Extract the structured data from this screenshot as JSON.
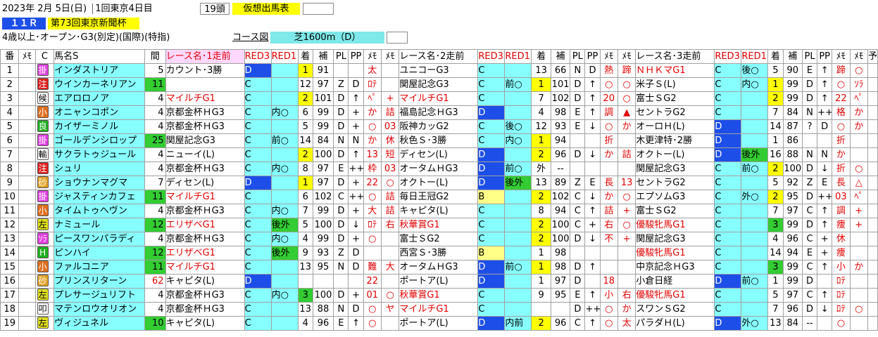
{
  "header": {
    "date": "2023年  2月  5日(日)",
    "meet": "1回東京4日目",
    "heads": "19頭",
    "tag": "仮想出馬表",
    "race_no": "１１Ｒ",
    "race_name": "第73回東京新聞杯",
    "condition": "4歳以上･オープン･G3(別定)(国際)(特指)",
    "course_label": "コース図",
    "course": "芝1600m（D）"
  },
  "head": {
    "ban": "番",
    "memo": "ﾒﾓ",
    "c": "C",
    "name": "馬名S",
    "kan": "間",
    "r1": "レース名･1走前",
    "r2": "レース名･2走前",
    "r3": "レース名･3走前",
    "k3": "RED3",
    "k1": "RED1",
    "chaku": "着",
    "ho": "補",
    "pl": "PL",
    "pp": "PP",
    "me": "ﾒﾓ",
    "nxt": "予"
  },
  "mark_colors": {
    "掛": "#e040e0",
    "注": "#e02020",
    "候": "#ffffff",
    "小": "#e07020",
    "良": "#20b020",
    "輸": "#ffffff",
    "砂": "#e0a020",
    "ｿﾗ": "#e040e0",
    "H": "#20b020",
    "左": "#e0e020",
    "叩": "#ffffff"
  },
  "rows": [
    {
      "n": "1",
      "m": "掛",
      "name": "インダストリア",
      "k": "5",
      "kc": "",
      "r1": {
        "name": "カウント･3勝",
        "red": false,
        "k3": "D",
        "k3c": "bl",
        "k1": "",
        "k1c": "cy",
        "ch": "1",
        "chc": "yl",
        "ho": "91",
        "pl": "",
        "pp": "",
        "m1": "太",
        "m2": ""
      },
      "r2": {
        "name": "ユニコーG3",
        "red": false,
        "k3": "C",
        "k3c": "cy",
        "k1": "",
        "k1c": "cy",
        "ch": "13",
        "chc": "",
        "ho": "66",
        "pl": "N",
        "pp": "D",
        "m1": "熱",
        "m2": "蹄"
      },
      "r3": {
        "name": "ＮＨＫマG1",
        "red": true,
        "k3": "C",
        "k3c": "cy",
        "k1": "後○",
        "k1c": "cy",
        "ch": "5",
        "chc": "",
        "ho": "90",
        "pl": "E",
        "pp": "↑",
        "m1": "蹄",
        "m2": "○"
      }
    },
    {
      "n": "2",
      "m": "注",
      "name": "ウインカーネリアン",
      "k": "11",
      "kc": "gr",
      "r1": {
        "name": "",
        "red": false,
        "k3": "C",
        "k3c": "cy",
        "k1": "",
        "k1c": "cy",
        "ch": "12",
        "chc": "",
        "ho": "97",
        "pl": "Z",
        "pp": "D",
        "m1": "ﾛﾃ",
        "m2": ""
      },
      "r2": {
        "name": "関屋記念G3",
        "red": false,
        "k3": "C",
        "k3c": "cy",
        "k1": "前○",
        "k1c": "cy",
        "ch": "1",
        "chc": "yl",
        "ho": "101",
        "pl": "D",
        "pp": "↑",
        "m1": "○",
        "m2": "○"
      },
      "r3": {
        "name": "米子Ｓ(L)",
        "red": false,
        "k3": "C",
        "k3c": "cy",
        "k1": "内○",
        "k1c": "cy",
        "ch": "1",
        "chc": "yl",
        "ho": "99",
        "pl": "D",
        "pp": "↑",
        "m1": "○",
        "m2": "ｿﾗ"
      }
    },
    {
      "n": "3",
      "m": "候",
      "name": "エアロロノア",
      "k": "4",
      "kc": "",
      "r1": {
        "name": "マイルチG1",
        "red": true,
        "k3": "C",
        "k3c": "cy",
        "k1": "",
        "k1c": "cy",
        "ch": "2",
        "chc": "yl",
        "ho": "101",
        "pl": "D",
        "pp": "↑",
        "m1": "ﾍﾟ",
        "m2": "+"
      },
      "r2": {
        "name": "マイルチG1",
        "red": true,
        "k3": "C",
        "k3c": "cy",
        "k1": "",
        "k1c": "cy",
        "ch": "7",
        "chc": "",
        "ho": "102",
        "pl": "D",
        "pp": "↑",
        "m1": "20",
        "m2": "○"
      },
      "r3": {
        "name": "富士ＳG2",
        "red": false,
        "k3": "C",
        "k3c": "cy",
        "k1": "",
        "k1c": "cy",
        "ch": "2",
        "chc": "yl",
        "ho": "99",
        "pl": "D",
        "pp": "↑",
        "m1": "22",
        "m2": "ﾍﾟ"
      }
    },
    {
      "n": "4",
      "m": "小",
      "name": "オニャンコポン",
      "k": "4",
      "kc": "",
      "r1": {
        "name": "京都金杯ＨG3",
        "red": false,
        "k3": "C",
        "k3c": "cy",
        "k1": "内○",
        "k1c": "cy",
        "ch": "6",
        "chc": "",
        "ho": "99",
        "pl": "D",
        "pp": "+",
        "m1": "か",
        "m2": "詰"
      },
      "r2": {
        "name": "福島記念ＨG3",
        "red": false,
        "k3": "D",
        "k3c": "bl",
        "k1": "",
        "k1c": "cy",
        "ch": "4",
        "chc": "",
        "ho": "98",
        "pl": "E",
        "pp": "↑",
        "m1": "調",
        "m2": "▲"
      },
      "r3": {
        "name": "セントラG2",
        "red": false,
        "k3": "C",
        "k3c": "cy",
        "k1": "",
        "k1c": "cy",
        "ch": "7",
        "chc": "",
        "ho": "84",
        "pl": "N",
        "pp": "++",
        "m1": "格",
        "m2": "か"
      }
    },
    {
      "n": "5",
      "m": "良",
      "name": "カイザーミノル",
      "k": "4",
      "kc": "",
      "r1": {
        "name": "京都金杯ＨG3",
        "red": false,
        "k3": "C",
        "k3c": "cy",
        "k1": "",
        "k1c": "cy",
        "ch": "5",
        "chc": "",
        "ho": "99",
        "pl": "D",
        "pp": "+",
        "m1": "○",
        "m2": "03"
      },
      "r2": {
        "name": "阪神カッG2",
        "red": false,
        "k3": "C",
        "k3c": "cy",
        "k1": "後○",
        "k1c": "cy",
        "ch": "12",
        "chc": "",
        "ho": "93",
        "pl": "E",
        "pp": "↓",
        "m1": "○",
        "m2": "か"
      },
      "r3": {
        "name": "オーロＨ(L)",
        "red": false,
        "k3": "D",
        "k3c": "bl",
        "k1": "",
        "k1c": "cy",
        "ch": "14",
        "chc": "",
        "ho": "87",
        "pl": "?",
        "pp": "D",
        "m1": "○",
        "m2": "か"
      }
    },
    {
      "n": "6",
      "m": "掛",
      "name": "ゴールデンシロップ",
      "k": "25",
      "kc": "gr",
      "r1": {
        "name": "関屋記念G3",
        "red": false,
        "k3": "C",
        "k3c": "cy",
        "k1": "前○",
        "k1c": "cy",
        "ch": "14",
        "chc": "",
        "ho": "84",
        "pl": "N",
        "pp": "N",
        "m1": "か",
        "m2": "休"
      },
      "r2": {
        "name": "秋色Ｓ･3勝",
        "red": false,
        "k3": "C",
        "k3c": "cy",
        "k1": "内○",
        "k1c": "cy",
        "ch": "1",
        "chc": "yl",
        "ho": "94",
        "pl": "",
        "pp": "",
        "m1": "折",
        "m2": ""
      },
      "r3": {
        "name": "木更津特･2勝",
        "red": false,
        "k3": "D",
        "k3c": "bl",
        "k1": "",
        "k1c": "cy",
        "ch": "1",
        "chc": "",
        "ho": "86",
        "pl": "",
        "pp": "",
        "m1": "折",
        "m2": ""
      }
    },
    {
      "n": "7",
      "m": "輸",
      "name": "サクラトゥジュール",
      "k": "4",
      "kc": "",
      "r1": {
        "name": "ニューイ(L)",
        "red": false,
        "k3": "C",
        "k3c": "cy",
        "k1": "",
        "k1c": "cy",
        "ch": "2",
        "chc": "yl",
        "ho": "100",
        "pl": "D",
        "pp": "↑",
        "m1": "13",
        "m2": "短"
      },
      "r2": {
        "name": "ディセン(L)",
        "red": false,
        "k3": "D",
        "k3c": "bl",
        "k1": "",
        "k1c": "cy",
        "ch": "2",
        "chc": "yl",
        "ho": "96",
        "pl": "D",
        "pp": "↓",
        "m1": "か",
        "m2": "詰"
      },
      "r3": {
        "name": "オクトー(L)",
        "red": false,
        "k3": "D",
        "k3c": "bl",
        "k1": "後外",
        "k1c": "gr",
        "ch": "16",
        "chc": "",
        "ho": "88",
        "pl": "N",
        "pp": "N",
        "m1": "か",
        "m2": ""
      }
    },
    {
      "n": "8",
      "m": "注",
      "name": "シュリ",
      "k": "4",
      "kc": "",
      "r1": {
        "name": "京都金杯ＨG3",
        "red": false,
        "k3": "C",
        "k3c": "cy",
        "k1": "内○",
        "k1c": "cy",
        "ch": "8",
        "chc": "",
        "ho": "97",
        "pl": "E",
        "pp": "++",
        "m1": "枠",
        "m2": "03"
      },
      "r2": {
        "name": "オータムＨG3",
        "red": false,
        "k3": "D",
        "k3c": "bl",
        "k1": "前○",
        "k1c": "cy",
        "ch": "外",
        "chc": "",
        "ho": "--",
        "pl": "",
        "pp": "",
        "m1": "",
        "m2": ""
      },
      "r3": {
        "name": "関屋記念G3",
        "red": false,
        "k3": "C",
        "k3c": "cy",
        "k1": "前○",
        "k1c": "cy",
        "ch": "2",
        "chc": "yl",
        "ho": "100",
        "pl": "D",
        "pp": "↓",
        "m1": "折",
        "m2": "○"
      }
    },
    {
      "n": "9",
      "m": "砂",
      "name": "ショウナンマグマ",
      "k": "7",
      "kc": "",
      "r1": {
        "name": "ディセン(L)",
        "red": false,
        "k3": "D",
        "k3c": "bl",
        "k1": "",
        "k1c": "cy",
        "ch": "1",
        "chc": "yl",
        "ho": "97",
        "pl": "D",
        "pp": "+",
        "m1": "22",
        "m2": "○"
      },
      "r2": {
        "name": "オクトー(L)",
        "red": false,
        "k3": "D",
        "k3c": "bl",
        "k1": "後外",
        "k1c": "gr",
        "ch": "13",
        "chc": "",
        "ho": "89",
        "pl": "Z",
        "pp": "E",
        "m1": "長",
        "m2": "13"
      },
      "r3": {
        "name": "セントラG2",
        "red": false,
        "k3": "C",
        "k3c": "cy",
        "k1": "",
        "k1c": "cy",
        "ch": "5",
        "chc": "",
        "ho": "92",
        "pl": "Z",
        "pp": "E",
        "m1": "長",
        "m2": "△"
      }
    },
    {
      "n": "10",
      "m": "掛",
      "name": "ジャスティンカフェ",
      "k": "11",
      "kc": "gr",
      "r1": {
        "name": "マイルチG1",
        "red": true,
        "k3": "C",
        "k3c": "cy",
        "k1": "",
        "k1c": "cy",
        "ch": "6",
        "chc": "",
        "ho": "102",
        "pl": "C",
        "pp": "++",
        "m1": "○",
        "m2": "詰"
      },
      "r2": {
        "name": "毎日王冠G2",
        "red": false,
        "k3": "B",
        "k3c": "y2",
        "k1": "",
        "k1c": "cy",
        "ch": "2",
        "chc": "yl",
        "ho": "102",
        "pl": "C",
        "pp": "↓",
        "m1": "か",
        "m2": "○"
      },
      "r3": {
        "name": "エプソムG3",
        "red": false,
        "k3": "C",
        "k3c": "cy",
        "k1": "外○",
        "k1c": "cy",
        "ch": "2",
        "chc": "yl",
        "ho": "95",
        "pl": "D",
        "pp": "++",
        "m1": "03",
        "m2": "ﾍﾟ"
      }
    },
    {
      "n": "11",
      "m": "小",
      "name": "タイムトゥヘヴン",
      "k": "4",
      "kc": "",
      "r1": {
        "name": "京都金杯ＨG3",
        "red": false,
        "k3": "C",
        "k3c": "cy",
        "k1": "内○",
        "k1c": "cy",
        "ch": "7",
        "chc": "",
        "ho": "99",
        "pl": "D",
        "pp": "+",
        "m1": "大",
        "m2": "詰"
      },
      "r2": {
        "name": "キャピタ(L)",
        "red": false,
        "k3": "C",
        "k3c": "cy",
        "k1": "",
        "k1c": "cy",
        "ch": "8",
        "chc": "",
        "ho": "94",
        "pl": "C",
        "pp": "↑",
        "m1": "詰",
        "m2": "+"
      },
      "r3": {
        "name": "富士ＳG2",
        "red": false,
        "k3": "C",
        "k3c": "cy",
        "k1": "",
        "k1c": "cy",
        "ch": "7",
        "chc": "",
        "ho": "97",
        "pl": "C",
        "pp": "↑",
        "m1": "調",
        "m2": "+"
      }
    },
    {
      "n": "12",
      "m": "左",
      "name": "ナミュール",
      "k": "12",
      "kc": "gr",
      "r1": {
        "name": "エリザベG1",
        "red": true,
        "k3": "C",
        "k3c": "cy",
        "k1": "後外",
        "k1c": "gr",
        "ch": "5",
        "chc": "",
        "ho": "100",
        "pl": "D",
        "pp": "↓",
        "m1": "ﾛﾃ",
        "m2": "右"
      },
      "r2": {
        "name": "秋華賞G1",
        "red": true,
        "k3": "C",
        "k3c": "cy",
        "k1": "",
        "k1c": "cy",
        "ch": "2",
        "chc": "yl",
        "ho": "100",
        "pl": "C",
        "pp": "+",
        "m1": "右",
        "m2": "○"
      },
      "r3": {
        "name": "優駿牝馬G1",
        "red": true,
        "k3": "C",
        "k3c": "cy",
        "k1": "",
        "k1c": "cy",
        "ch": "3",
        "chc": "gr",
        "ho": "99",
        "pl": "D",
        "pp": "↑",
        "m1": "痩",
        "m2": "+"
      }
    },
    {
      "n": "13",
      "m": "ｿﾗ",
      "name": "ピースワンパラディ",
      "k": "4",
      "kc": "",
      "r1": {
        "name": "京都金杯ＨG3",
        "red": false,
        "k3": "C",
        "k3c": "cy",
        "k1": "内○",
        "k1c": "cy",
        "ch": "4",
        "chc": "",
        "ho": "99",
        "pl": "D",
        "pp": "+",
        "m1": "○",
        "m2": ""
      },
      "r2": {
        "name": "富士ＳG2",
        "red": false,
        "k3": "C",
        "k3c": "cy",
        "k1": "",
        "k1c": "cy",
        "ch": "2",
        "chc": "yl",
        "ho": "100",
        "pl": "D",
        "pp": "↓",
        "m1": "不",
        "m2": "+"
      },
      "r3": {
        "name": "関屋記念G3",
        "red": false,
        "k3": "C",
        "k3c": "cy",
        "k1": "",
        "k1c": "cy",
        "ch": "4",
        "chc": "",
        "ho": "96",
        "pl": "C",
        "pp": "+",
        "m1": "休",
        "m2": ""
      }
    },
    {
      "n": "14",
      "m": "H",
      "name": "ピンハイ",
      "k": "12",
      "kc": "gr",
      "r1": {
        "name": "エリザベG1",
        "red": true,
        "k3": "C",
        "k3c": "cy",
        "k1": "後外",
        "k1c": "gr",
        "ch": "9",
        "chc": "",
        "ho": "93",
        "pl": "Z",
        "pp": "D",
        "m1": "",
        "m2": ""
      },
      "r2": {
        "name": "西宮Ｓ･3勝",
        "red": false,
        "k3": "B",
        "k3c": "y2",
        "k1": "",
        "k1c": "cy",
        "ch": "1",
        "chc": "",
        "ho": "98",
        "pl": "",
        "pp": "",
        "m1": "",
        "m2": ""
      },
      "r3": {
        "name": "優駿牝馬G1",
        "red": true,
        "k3": "C",
        "k3c": "cy",
        "k1": "",
        "k1c": "cy",
        "ch": "14",
        "chc": "",
        "ho": "94",
        "pl": "E",
        "pp": "+",
        "m1": "痩",
        "m2": ""
      }
    },
    {
      "n": "15",
      "m": "小",
      "name": "ファルコニア",
      "k": "11",
      "kc": "gr",
      "r1": {
        "name": "マイルチG1",
        "red": true,
        "k3": "C",
        "k3c": "cy",
        "k1": "",
        "k1c": "cy",
        "ch": "13",
        "chc": "",
        "ho": "95",
        "pl": "N",
        "pp": "D",
        "m1": "難",
        "m2": "大"
      },
      "r2": {
        "name": "オータムＨG3",
        "red": false,
        "k3": "D",
        "k3c": "bl",
        "k1": "前○",
        "k1c": "cy",
        "ch": "1",
        "chc": "yl",
        "ho": "98",
        "pl": "D",
        "pp": "↑",
        "m1": "",
        "m2": ""
      },
      "r3": {
        "name": "中京記念ＨG3",
        "red": false,
        "k3": "C",
        "k3c": "cy",
        "k1": "",
        "k1c": "cy",
        "ch": "3",
        "chc": "gr",
        "ho": "99",
        "pl": "C",
        "pp": "↑",
        "m1": "小",
        "m2": "か"
      }
    },
    {
      "n": "16",
      "m": "砂",
      "name": "プリンスリターン",
      "k": "62",
      "kc": "red",
      "r1": {
        "name": "キャピタ(L)",
        "red": false,
        "k3": "D",
        "k3c": "bl",
        "k1": "",
        "k1c": "cy",
        "ch": "",
        "chc": "",
        "ho": "",
        "pl": "",
        "pp": "",
        "m1": "22",
        "m2": ""
      },
      "r2": {
        "name": "ポートア(L)",
        "red": false,
        "k3": "D",
        "k3c": "bl",
        "k1": "",
        "k1c": "cy",
        "ch": "1",
        "chc": "",
        "ho": "97",
        "pl": "D",
        "pp": "",
        "m1": "18",
        "m2": ""
      },
      "r3": {
        "name": "小倉日経",
        "red": false,
        "k3": "D",
        "k3c": "bl",
        "k1": "前○",
        "k1c": "cy",
        "ch": "1",
        "chc": "",
        "ho": "99",
        "pl": "D",
        "pp": "",
        "m1": "ﾛﾃ",
        "m2": ""
      }
    },
    {
      "n": "17",
      "m": "左",
      "name": "プレサージュリフト",
      "k": "4",
      "kc": "",
      "r1": {
        "name": "京都金杯ＨG3",
        "red": false,
        "k3": "C",
        "k3c": "cy",
        "k1": "内○",
        "k1c": "cy",
        "ch": "3",
        "chc": "gr",
        "ho": "100",
        "pl": "D",
        "pp": "+",
        "m1": "01",
        "m2": "○"
      },
      "r2": {
        "name": "秋華賞G1",
        "red": true,
        "k3": "C",
        "k3c": "cy",
        "k1": "",
        "k1c": "cy",
        "ch": "9",
        "chc": "",
        "ho": "95",
        "pl": "E",
        "pp": "↑",
        "m1": "小",
        "m2": "右"
      },
      "r3": {
        "name": "優駿牝馬G1",
        "red": true,
        "k3": "C",
        "k3c": "cy",
        "k1": "",
        "k1c": "cy",
        "ch": "5",
        "chc": "",
        "ho": "97",
        "pl": "C",
        "pp": "↑",
        "m1": "ﾛﾃ",
        "m2": ""
      }
    },
    {
      "n": "18",
      "m": "叩",
      "name": "マテンロウオリオン",
      "k": "4",
      "kc": "",
      "r1": {
        "name": "京都金杯ＨG3",
        "red": false,
        "k3": "C",
        "k3c": "cy",
        "k1": "",
        "k1c": "cy",
        "ch": "13",
        "chc": "",
        "ho": "88",
        "pl": "N",
        "pp": "D",
        "m1": "○",
        "m2": "ヤ"
      },
      "r2": {
        "name": "マイルチG1",
        "red": true,
        "k3": "C",
        "k3c": "cy",
        "k1": "",
        "k1c": "cy",
        "ch": "",
        "chc": "",
        "ho": "",
        "pl": "D",
        "pp": "++",
        "m1": "○",
        "m2": "か"
      },
      "r3": {
        "name": "スワンＳG2",
        "red": false,
        "k3": "C",
        "k3c": "cy",
        "k1": "",
        "k1c": "cy",
        "ch": "7",
        "chc": "",
        "ho": "96",
        "pl": "D",
        "pp": "↓",
        "m1": "ﾛﾃ",
        "m2": "○"
      }
    },
    {
      "n": "19",
      "m": "左",
      "name": "ヴィジュネル",
      "k": "10",
      "kc": "gr",
      "r1": {
        "name": "キャピタ(L)",
        "red": false,
        "k3": "C",
        "k3c": "cy",
        "k1": "",
        "k1c": "cy",
        "ch": "4",
        "chc": "",
        "ho": "96",
        "pl": "E",
        "pp": "↑",
        "m1": "○",
        "m2": ""
      },
      "r2": {
        "name": "ポートア(L)",
        "red": false,
        "k3": "D",
        "k3c": "bl",
        "k1": "内前",
        "k1c": "cy",
        "ch": "2",
        "chc": "yl",
        "ho": "96",
        "pl": "C",
        "pp": "↑",
        "m1": "○",
        "m2": "太"
      },
      "r3": {
        "name": "パラダＨ(L)",
        "red": false,
        "k3": "D",
        "k3c": "bl",
        "k1": "外○",
        "k1c": "cy",
        "ch": "13",
        "chc": "",
        "ho": "84",
        "pl": "--",
        "pp": "",
        "m1": "○",
        "m2": ""
      }
    }
  ]
}
